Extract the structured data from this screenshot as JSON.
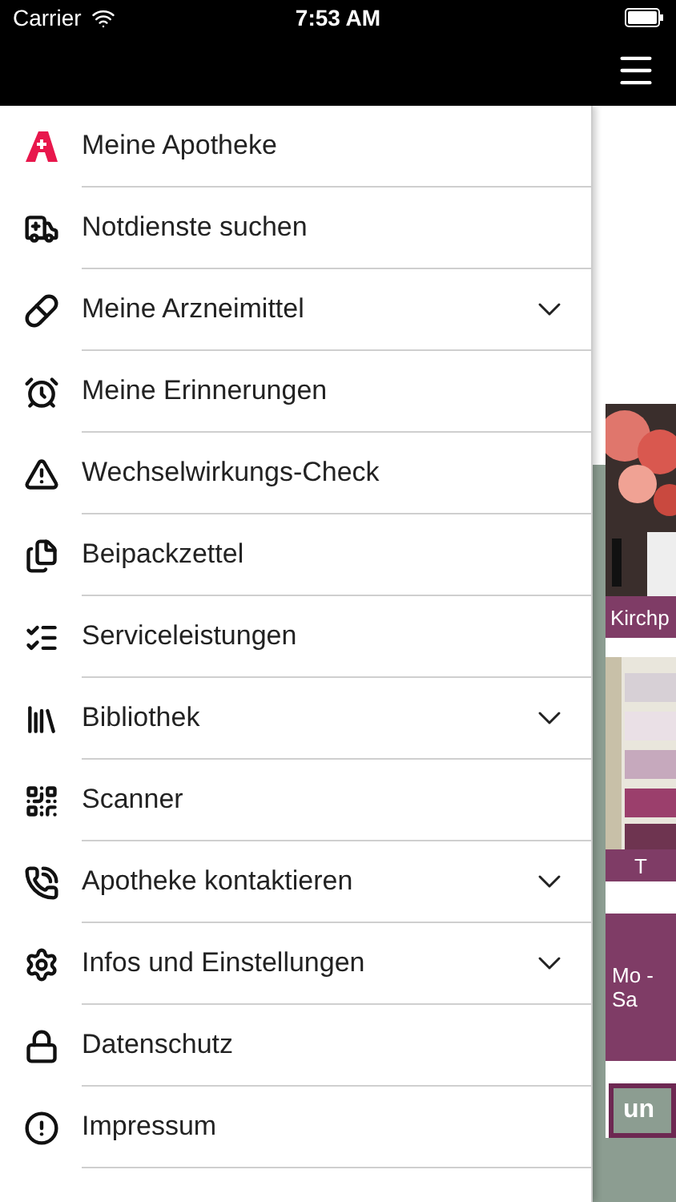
{
  "status_bar": {
    "carrier": "Carrier",
    "time": "7:53 AM"
  },
  "menu": {
    "items": [
      {
        "label": "Meine Apotheke",
        "expandable": false
      },
      {
        "label": "Notdienste suchen",
        "expandable": false
      },
      {
        "label": "Meine Arzneimittel",
        "expandable": true
      },
      {
        "label": "Meine Erinnerungen",
        "expandable": false
      },
      {
        "label": "Wechselwirkungs-Check",
        "expandable": false
      },
      {
        "label": "Beipackzettel",
        "expandable": false
      },
      {
        "label": "Serviceleistungen",
        "expandable": false
      },
      {
        "label": "Bibliothek",
        "expandable": true
      },
      {
        "label": "Scanner",
        "expandable": false
      },
      {
        "label": "Apotheke kontaktieren",
        "expandable": true
      },
      {
        "label": "Infos und Einstellungen",
        "expandable": true
      },
      {
        "label": "Datenschutz",
        "expandable": false
      },
      {
        "label": "Impressum",
        "expandable": false
      }
    ]
  },
  "background_page": {
    "banners": [
      {
        "kind": "picture",
        "caption": "Kirchp"
      },
      {
        "kind": "picture",
        "caption": "T"
      }
    ],
    "hours": [
      "Mo -",
      "Sa"
    ],
    "button": "un"
  }
}
